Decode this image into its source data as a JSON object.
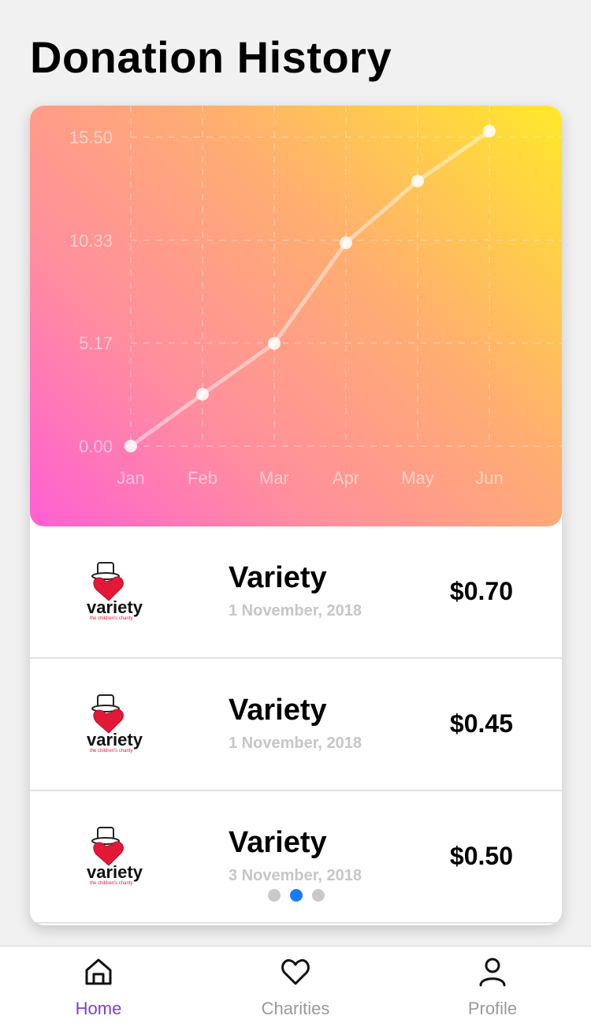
{
  "page": {
    "title": "Donation History"
  },
  "chart_data": {
    "type": "line",
    "x": [
      "Jan",
      "Feb",
      "Mar",
      "Apr",
      "May",
      "Jun"
    ],
    "series": [
      {
        "values": [
          0.0,
          2.6,
          5.15,
          10.2,
          13.3,
          15.8
        ]
      }
    ],
    "yticks": [
      "0.00",
      "5.17",
      "10.33",
      "15.50"
    ],
    "ylim": [
      0,
      15.5
    ],
    "grid": true,
    "gradient_colors": [
      "#ff5fd3",
      "#ffe92a"
    ]
  },
  "donations": [
    {
      "name": "Variety",
      "date": "1 November, 2018",
      "amount": "$0.70",
      "logo_word": "variety",
      "logo_tagline": "the children's charity"
    },
    {
      "name": "Variety",
      "date": "1 November, 2018",
      "amount": "$0.45",
      "logo_word": "variety",
      "logo_tagline": "the children's charity"
    },
    {
      "name": "Variety",
      "date": "3 November, 2018",
      "amount": "$0.50",
      "logo_word": "variety",
      "logo_tagline": "the children's charity"
    }
  ],
  "pager": {
    "count": 3,
    "active": 2
  },
  "tabbar": {
    "tabs": [
      {
        "label": "Home",
        "icon": "home-icon",
        "active": true
      },
      {
        "label": "Charities",
        "icon": "heart-icon",
        "active": false
      },
      {
        "label": "Profile",
        "icon": "profile-icon",
        "active": false
      }
    ],
    "active_color": "#7d3fd0",
    "inactive_color": "#9a9a9a"
  }
}
